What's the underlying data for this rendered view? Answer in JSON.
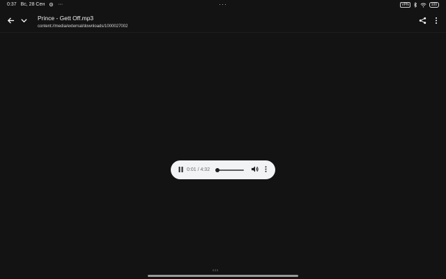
{
  "status_bar": {
    "time": "0:37",
    "date": "Вс, 28 Сен",
    "more_dots": "···",
    "center_dots": "···",
    "vpn_label": "VPN",
    "battery_level": "100"
  },
  "toolbar": {
    "back_icon": "arrow-back-icon",
    "collapse_icon": "chevron-down-icon",
    "title": "Prince - Gett Off.mp3",
    "path": "content://media/external/downloads/1000027002",
    "share_icon": "share-icon",
    "more_icon": "more-vert-icon"
  },
  "player": {
    "time_readout": "0:01 / 4:32",
    "progress_fraction": 0.004,
    "pause_icon": "pause-icon",
    "volume_icon": "volume-icon",
    "more_icon": "more-vert-icon"
  },
  "colors": {
    "background": "#131313",
    "player_bg": "#f1f3f4",
    "home_bar": "#9a9a9a"
  }
}
